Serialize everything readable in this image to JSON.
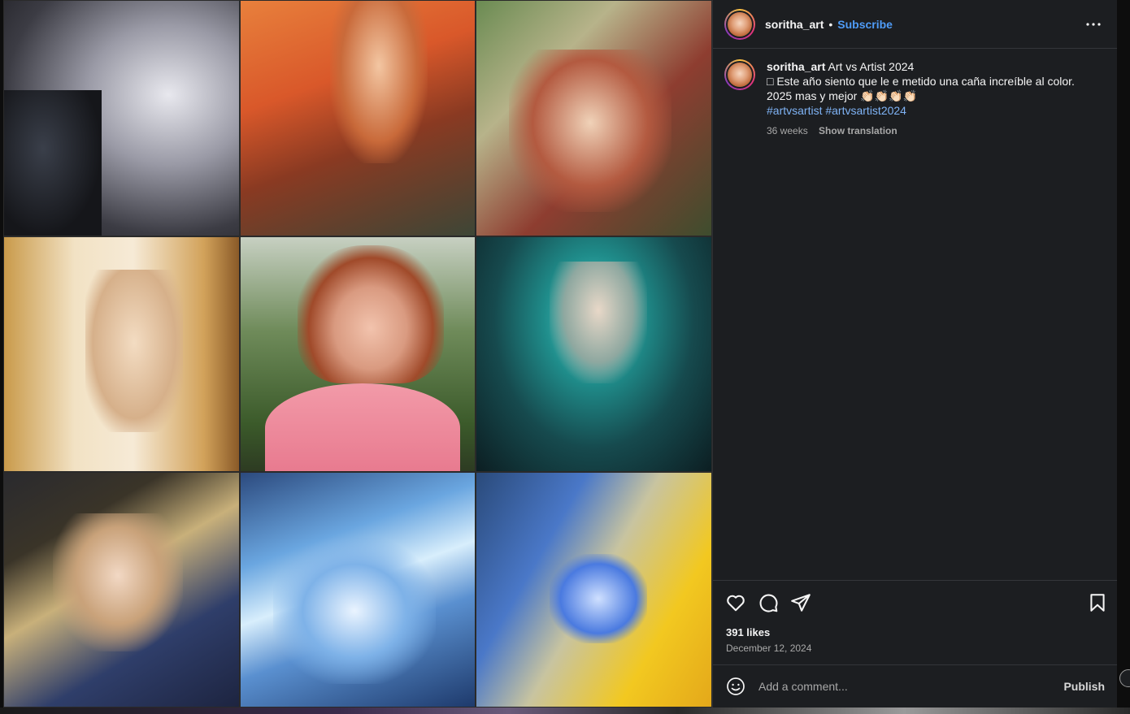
{
  "header": {
    "username": "soritha_art",
    "separator": "•",
    "subscribe_label": "Subscribe",
    "more_label": "···"
  },
  "caption": {
    "username": "soritha_art",
    "title": "Art vs Artist 2024",
    "line1": "□ Este año siento que le e metido una caña increíble al color.",
    "line2": "2025 mas y mejor 👏🏻👏🏻👏🏻👏🏻",
    "hashtags": [
      "#artvsartist",
      "#artvsartist2024"
    ],
    "age": "36 weeks",
    "translate_label": "Show translation"
  },
  "engagement": {
    "likes": "391 likes",
    "date": "December 12, 2024"
  },
  "comment": {
    "placeholder": "Add a comment...",
    "publish_label": "Publish"
  },
  "icons": {
    "like": "heart-icon",
    "comment": "comment-bubble-icon",
    "share": "paper-plane-icon",
    "save": "bookmark-icon",
    "emoji": "smiley-icon",
    "more": "more-horizontal-icon"
  },
  "colors": {
    "panel_bg": "#1c1e21",
    "link_blue": "#4f9cf7",
    "hashtag_blue": "#7fb3f5",
    "text_primary": "#f5f5f5",
    "text_secondary": "#a8a8a8"
  },
  "grid": {
    "tiles": [
      "white-haired-character-with-crow",
      "orange-lit-character-signed",
      "embracing-couple-signed",
      "blond-long-haired-man-closeup",
      "artist-photo-with-sunflowers",
      "underwater-mermaid",
      "sleeping-elf-couple",
      "blue-water-face",
      "blue-flower-yellow-hair"
    ]
  }
}
